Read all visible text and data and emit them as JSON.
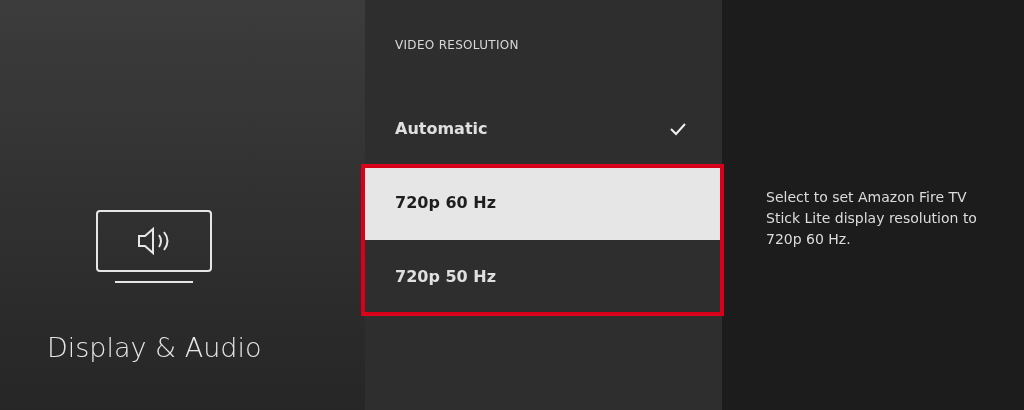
{
  "category": {
    "title": "Display & Audio"
  },
  "list": {
    "heading": "VIDEO RESOLUTION",
    "options": [
      {
        "label": "Automatic",
        "checked": true,
        "selected": false,
        "framed": false
      },
      {
        "label": "720p 60 Hz",
        "checked": false,
        "selected": true,
        "framed": true
      },
      {
        "label": "720p 50 Hz",
        "checked": false,
        "selected": false,
        "framed": true
      }
    ]
  },
  "description": "Select to set Amazon Fire TV Stick Lite display resolution to 720p 60 Hz."
}
